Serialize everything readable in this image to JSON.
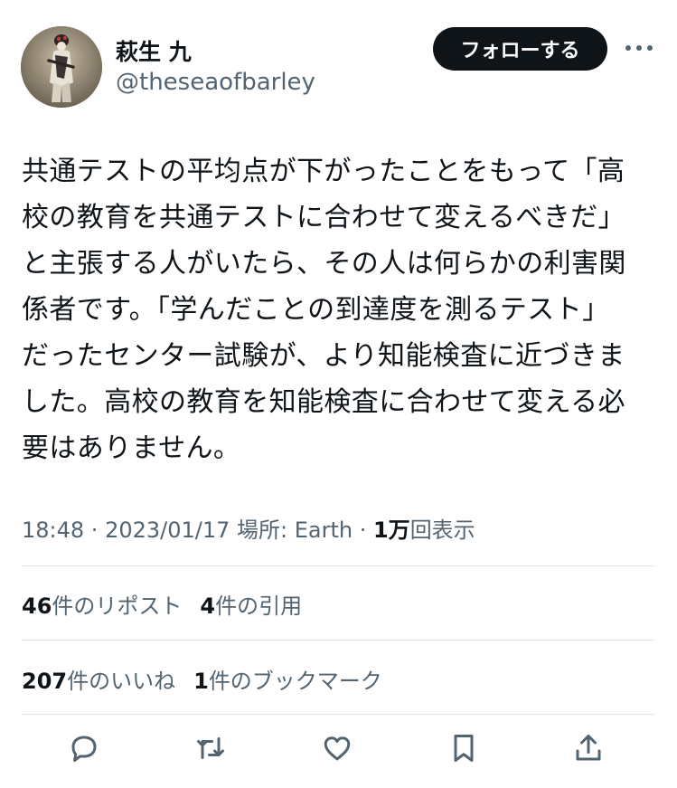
{
  "user": {
    "display_name": "萩生 九",
    "handle": "@theseaofbarley",
    "avatar_icon": "profile-photo",
    "follow_label": "フォローする",
    "more_icon": "more-icon"
  },
  "tweet": {
    "lines": [
      "共通テストの平均点が下がったことをもって「高",
      "校の教育を共通テストに合わせて変えるべきだ」",
      "と主張する人がいたら、その人は何らかの利害関",
      "係者です。「学んだことの到達度を測るテスト」",
      "だったセンター試験が、より知能検査に近づきま",
      "した。高校の教育を知能検査に合わせて変える必",
      "要はありません。"
    ]
  },
  "meta": {
    "time": "18:48",
    "sep1": " · ",
    "date": "2023/01/17",
    "location": " 場所: Earth",
    "sep2": " · ",
    "views_count": "1万",
    "views_label": "回表示"
  },
  "stats": {
    "reposts_count": "46",
    "reposts_label": "件のリポスト",
    "quotes_count": "4",
    "quotes_label": "件の引用",
    "likes_count": "207",
    "likes_label": "件のいいね",
    "bookmarks_count": "1",
    "bookmarks_label": "件のブックマーク"
  },
  "actions": [
    "reply-icon",
    "repost-icon",
    "like-icon",
    "bookmark-icon",
    "share-icon"
  ],
  "colors": {
    "text": "#0f1419",
    "secondary": "#536471",
    "divider": "#e3e6e9",
    "button_bg": "#0f1419"
  }
}
